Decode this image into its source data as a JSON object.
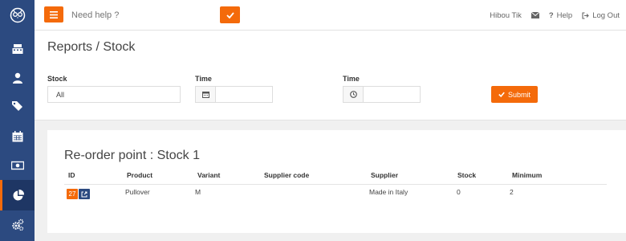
{
  "sidebar": {
    "logo_icon": "owl-logo-icon",
    "items": [
      {
        "icon": "cash-register-icon"
      },
      {
        "icon": "user-icon"
      },
      {
        "icon": "tags-icon"
      },
      {
        "icon": "calendar-icon"
      },
      {
        "icon": "money-icon"
      },
      {
        "icon": "pie-chart-icon",
        "active": true
      },
      {
        "icon": "cogs-icon"
      }
    ]
  },
  "topbar": {
    "help_placeholder": "Need help ?",
    "user_name": "Hibou Tik",
    "help_label": "Help",
    "logout_label": "Log Out"
  },
  "page": {
    "title": "Reports / Stock"
  },
  "filters": {
    "stock_label": "Stock",
    "stock_value": "All",
    "time1_label": "Time",
    "time1_value": "",
    "time2_label": "Time",
    "time2_value": "",
    "submit_label": "Submit"
  },
  "report": {
    "title": "Re-order point : Stock 1",
    "columns": [
      "ID",
      "Product",
      "Variant",
      "Supplier code",
      "Supplier",
      "Stock",
      "Minimum"
    ],
    "rows": [
      {
        "id": "27",
        "product": "Pullover",
        "variant": "M",
        "supplier_code": "",
        "supplier": "Made in Italy",
        "stock": "0",
        "minimum": "2"
      }
    ]
  },
  "colors": {
    "accent": "#f46a0a",
    "sidebar": "#2c4a80"
  }
}
